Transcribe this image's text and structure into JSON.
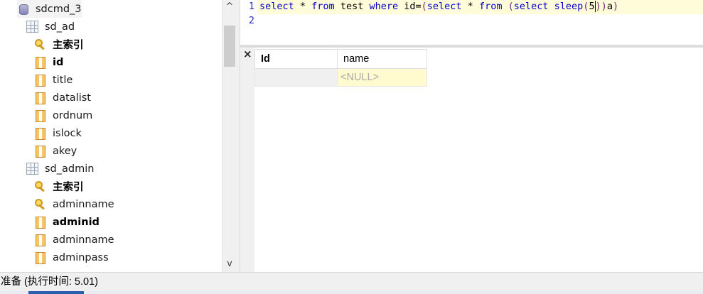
{
  "tree": {
    "nodes": [
      {
        "label": "sdcmd_3",
        "icon": "database-icon",
        "indent": 0,
        "bold": false
      },
      {
        "label": "sd_ad",
        "icon": "table-icon",
        "indent": 1,
        "bold": false
      },
      {
        "label": "主索引",
        "icon": "key-icon",
        "indent": 2,
        "bold": true
      },
      {
        "label": "id",
        "icon": "column-icon",
        "indent": 2,
        "bold": true
      },
      {
        "label": "title",
        "icon": "column-icon",
        "indent": 2,
        "bold": false
      },
      {
        "label": "datalist",
        "icon": "column-icon",
        "indent": 2,
        "bold": false
      },
      {
        "label": "ordnum",
        "icon": "column-icon",
        "indent": 2,
        "bold": false
      },
      {
        "label": "islock",
        "icon": "column-icon",
        "indent": 2,
        "bold": false
      },
      {
        "label": "akey",
        "icon": "column-icon",
        "indent": 2,
        "bold": false
      },
      {
        "label": "sd_admin",
        "icon": "table-icon",
        "indent": 1,
        "bold": false
      },
      {
        "label": "主索引",
        "icon": "key-icon",
        "indent": 2,
        "bold": true
      },
      {
        "label": "adminname",
        "icon": "key-icon",
        "indent": 2,
        "bold": false
      },
      {
        "label": "adminid",
        "icon": "column-icon",
        "indent": 2,
        "bold": true
      },
      {
        "label": "adminname",
        "icon": "column-icon",
        "indent": 2,
        "bold": false
      },
      {
        "label": "adminpass",
        "icon": "column-icon",
        "indent": 2,
        "bold": false
      }
    ]
  },
  "scrollbar": {
    "up_glyph": "^",
    "down_glyph": "v"
  },
  "editor": {
    "line_numbers": [
      "1",
      "2"
    ],
    "code_line1": {
      "t1": "select",
      "t2": " * ",
      "t3": "from",
      "t4": " test ",
      "t5": "where",
      "t6": " id=",
      "t7": "(",
      "t8": "select",
      "t9": " * ",
      "t10": "from",
      "t11": " ",
      "t12": "(",
      "t13": "select",
      "t14": " ",
      "t15": "sleep",
      "t16": "(",
      "t17": "5",
      "t18": ")",
      "t19": ")",
      "t20": "a",
      "t21": ")"
    }
  },
  "results": {
    "close_glyph": "×",
    "columns": [
      "Id",
      "name"
    ],
    "rows": [
      [
        "",
        "<NULL>"
      ]
    ]
  },
  "status": {
    "text": "准备  (执行时间: 5.01)"
  }
}
